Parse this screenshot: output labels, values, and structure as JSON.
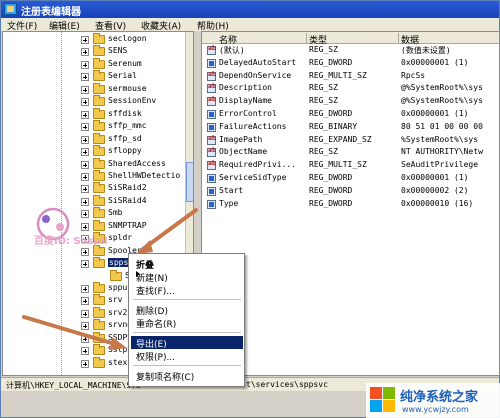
{
  "window": {
    "title": "注册表编辑器"
  },
  "menubar": [
    {
      "label": "文件(F)",
      "name": "menu-file"
    },
    {
      "label": "编辑(E)",
      "name": "menu-edit"
    },
    {
      "label": "查看(V)",
      "name": "menu-view"
    },
    {
      "label": "收藏夹(A)",
      "name": "menu-favorites"
    },
    {
      "label": "帮助(H)",
      "name": "menu-help"
    }
  ],
  "tree": {
    "items": [
      {
        "label": "seclogon"
      },
      {
        "label": "SENS"
      },
      {
        "label": "Serenum"
      },
      {
        "label": "Serial"
      },
      {
        "label": "sermouse"
      },
      {
        "label": "SessionEnv"
      },
      {
        "label": "sffdisk"
      },
      {
        "label": "sffp_mmc"
      },
      {
        "label": "sffp_sd"
      },
      {
        "label": "sfloppy"
      },
      {
        "label": "SharedAccess"
      },
      {
        "label": "ShellHWDetectio"
      },
      {
        "label": "SiSRaid2"
      },
      {
        "label": "SiSRaid4"
      },
      {
        "label": "Smb"
      },
      {
        "label": "SNMPTRAP"
      },
      {
        "label": "spldr"
      },
      {
        "label": "Spooler"
      },
      {
        "label": "sppsvc",
        "selected": true
      },
      {
        "label": "Secu",
        "child": true
      },
      {
        "label": "sppuin"
      },
      {
        "label": "srv"
      },
      {
        "label": "srv2"
      },
      {
        "label": "srvnet"
      },
      {
        "label": "SSDPSRV"
      },
      {
        "label": "SstpSvc"
      },
      {
        "label": "stexsto"
      }
    ]
  },
  "list": {
    "columns": [
      "名称",
      "类型",
      "数据"
    ],
    "rows": [
      {
        "name": "(默认)",
        "type": "REG_SZ",
        "data": "(数值未设置)",
        "icon": "string-value-icon"
      },
      {
        "name": "DelayedAutoStart",
        "type": "REG_DWORD",
        "data": "0x00000001 (1)",
        "icon": "binary-value-icon"
      },
      {
        "name": "DependOnService",
        "type": "REG_MULTI_SZ",
        "data": "RpcSs",
        "icon": "string-value-icon"
      },
      {
        "name": "Description",
        "type": "REG_SZ",
        "data": "@%SystemRoot%\\sys",
        "icon": "string-value-icon"
      },
      {
        "name": "DisplayName",
        "type": "REG_SZ",
        "data": "@%SystemRoot%\\sys",
        "icon": "string-value-icon"
      },
      {
        "name": "ErrorControl",
        "type": "REG_DWORD",
        "data": "0x00000001 (1)",
        "icon": "binary-value-icon"
      },
      {
        "name": "FailureActions",
        "type": "REG_BINARY",
        "data": "80 51 01 00 00 00",
        "icon": "binary-value-icon"
      },
      {
        "name": "ImagePath",
        "type": "REG_EXPAND_SZ",
        "data": "%SystemRoot%\\sys",
        "icon": "string-value-icon"
      },
      {
        "name": "ObjectName",
        "type": "REG_SZ",
        "data": "NT AUTHORITY\\Netw",
        "icon": "string-value-icon"
      },
      {
        "name": "RequiredPrivi...",
        "type": "REG_MULTI_SZ",
        "data": "SeAuditPrivilege",
        "icon": "string-value-icon"
      },
      {
        "name": "ServiceSidType",
        "type": "REG_DWORD",
        "data": "0x00000001 (1)",
        "icon": "binary-value-icon"
      },
      {
        "name": "Start",
        "type": "REG_DWORD",
        "data": "0x00000002 (2)",
        "icon": "binary-value-icon"
      },
      {
        "name": "Type",
        "type": "REG_DWORD",
        "data": "0x00000010 (16)",
        "icon": "binary-value-icon"
      }
    ]
  },
  "context_menu": {
    "items": [
      {
        "label": "折叠",
        "bold": true
      },
      {
        "label": "新建(N)",
        "submenu": true
      },
      {
        "label": "查找(F)..."
      },
      {
        "sep": true
      },
      {
        "label": "删除(D)"
      },
      {
        "label": "重命名(R)"
      },
      {
        "sep": true
      },
      {
        "label": "导出(E)",
        "highlighted": true
      },
      {
        "label": "权限(P)..."
      },
      {
        "sep": true
      },
      {
        "label": "复制项名称(C)"
      }
    ]
  },
  "statusbar": {
    "path": "计算机\\HKEY_LOCAL_MACHINE\\SYS",
    "path_tail": "t\\services\\sppsvc"
  },
  "watermark": {
    "text": "百度ID: Saspil"
  },
  "corner_logo": {
    "title": "纯净系统之家",
    "url": "www.ycwjzy.com"
  },
  "colors": {
    "title_bar": "#1843b8",
    "selection": "#0a246a",
    "arrow": "#c8774a",
    "folder": "#f2c94c"
  }
}
